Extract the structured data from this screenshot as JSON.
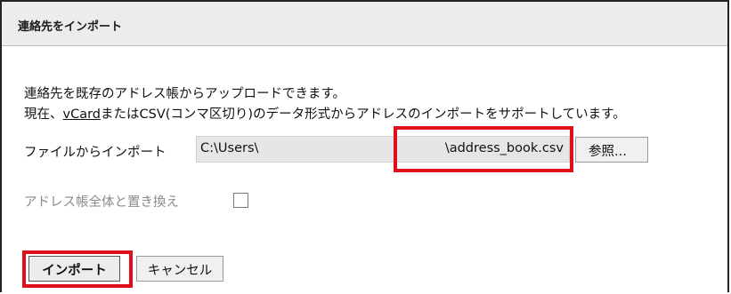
{
  "dialog": {
    "title": "連絡先をインポート",
    "description_line1": "連絡先を既存のアドレス帳からアップロードできます。",
    "description_line2_prefix": "現在、",
    "description_line2_link": "vCard",
    "description_line2_suffix": "またはCSV(コンマ区切り)のデータ形式からアドレスのインポートをサポートしています。"
  },
  "file_row": {
    "label": "ファイルからインポート",
    "path_text": "C:\\Users\\",
    "filename_text": "\\address_book.csv",
    "browse_label": "参照..."
  },
  "replace_row": {
    "label": "アドレス帳全体と置き換え",
    "checked": false
  },
  "buttons": {
    "import_label": "インポート",
    "cancel_label": "キャンセル"
  },
  "colors": {
    "highlight": "#e0101a",
    "titlebar": "#ececec",
    "field_bg": "#e6e6e6"
  }
}
